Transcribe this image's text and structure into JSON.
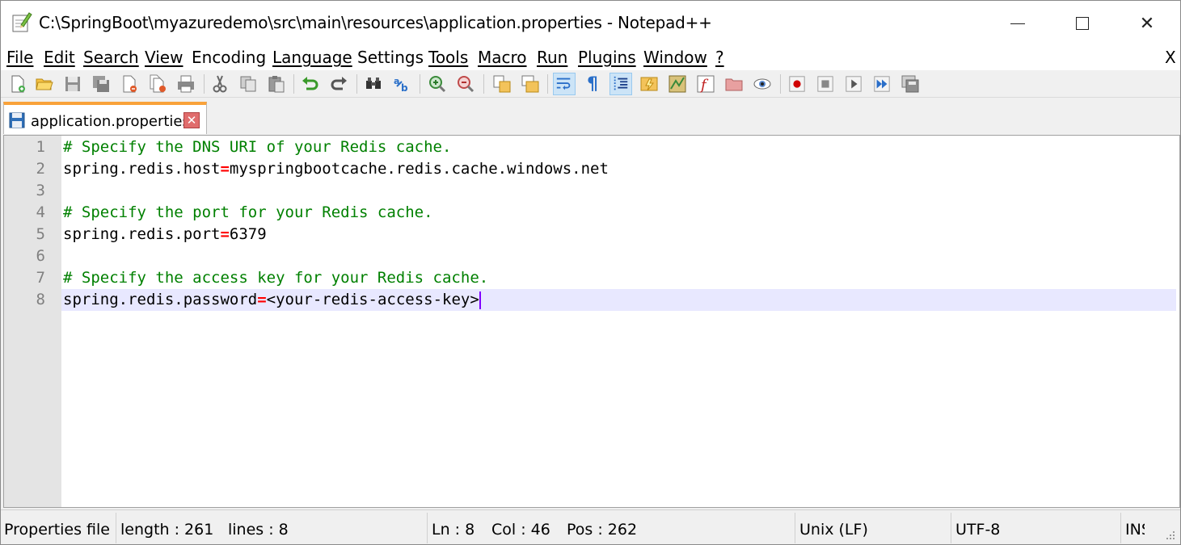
{
  "window": {
    "title": "C:\\SpringBoot\\myazuredemo\\src\\main\\resources\\application.properties - Notepad++",
    "minimize_label": "",
    "close_label": "✕",
    "menu_close_label": "X"
  },
  "menu": {
    "items": [
      {
        "label": "File"
      },
      {
        "label": "Edit"
      },
      {
        "label": "Search"
      },
      {
        "label": "View"
      },
      {
        "label": "Encoding"
      },
      {
        "label": "Language"
      },
      {
        "label": "Settings"
      },
      {
        "label": "Tools"
      },
      {
        "label": "Macro"
      },
      {
        "label": "Run"
      },
      {
        "label": "Plugins"
      },
      {
        "label": "Window"
      },
      {
        "label": "?"
      }
    ]
  },
  "toolbar": {
    "icons": [
      "new-file-icon",
      "open-file-icon",
      "save-icon",
      "save-all-icon",
      "close-icon",
      "close-all-icon",
      "print-icon",
      "cut-icon",
      "copy-icon",
      "paste-icon",
      "undo-icon",
      "redo-icon",
      "find-icon",
      "replace-icon",
      "zoom-in-icon",
      "zoom-out-icon",
      "sync-vertical-icon",
      "sync-horizontal-icon",
      "word-wrap-icon",
      "show-all-chars-icon",
      "indent-guide-icon",
      "udl-icon",
      "doc-map-icon",
      "function-list-icon",
      "folder-workspace-icon",
      "monitoring-icon",
      "record-macro-icon",
      "stop-recording-icon",
      "playback-macro-icon",
      "run-macro-multiple-icon",
      "save-macro-icon"
    ],
    "active": [
      "word-wrap-icon",
      "indent-guide-icon"
    ]
  },
  "tab": {
    "label": "application.properties",
    "close_label": "✕"
  },
  "editor": {
    "lines": [
      {
        "number": "1",
        "comment": "# Specify the DNS URI of your Redis cache."
      },
      {
        "number": "2",
        "key": "spring.redis.host",
        "eq": "=",
        "value": "myspringbootcache.redis.cache.windows.net"
      },
      {
        "number": "3"
      },
      {
        "number": "4",
        "comment": "# Specify the port for your Redis cache."
      },
      {
        "number": "5",
        "key": "spring.redis.port",
        "eq": "=",
        "value": "6379"
      },
      {
        "number": "6"
      },
      {
        "number": "7",
        "comment": "# Specify the access key for your Redis cache."
      },
      {
        "number": "8",
        "key": "spring.redis.password",
        "eq": "=",
        "value": "<your-redis-access-key>"
      }
    ]
  },
  "status": {
    "file_type": "Properties file",
    "length": "length : 261",
    "lines": "lines : 8",
    "ln": "Ln : 8",
    "col": "Col : 46",
    "pos": "Pos : 262",
    "eol": "Unix (LF)",
    "encoding": "UTF-8",
    "mode": "INS"
  },
  "colors": {
    "comment": "#008000",
    "operator": "#ff0000",
    "current_line": "#e8e8ff",
    "tab_accent": "#f9a23a"
  }
}
